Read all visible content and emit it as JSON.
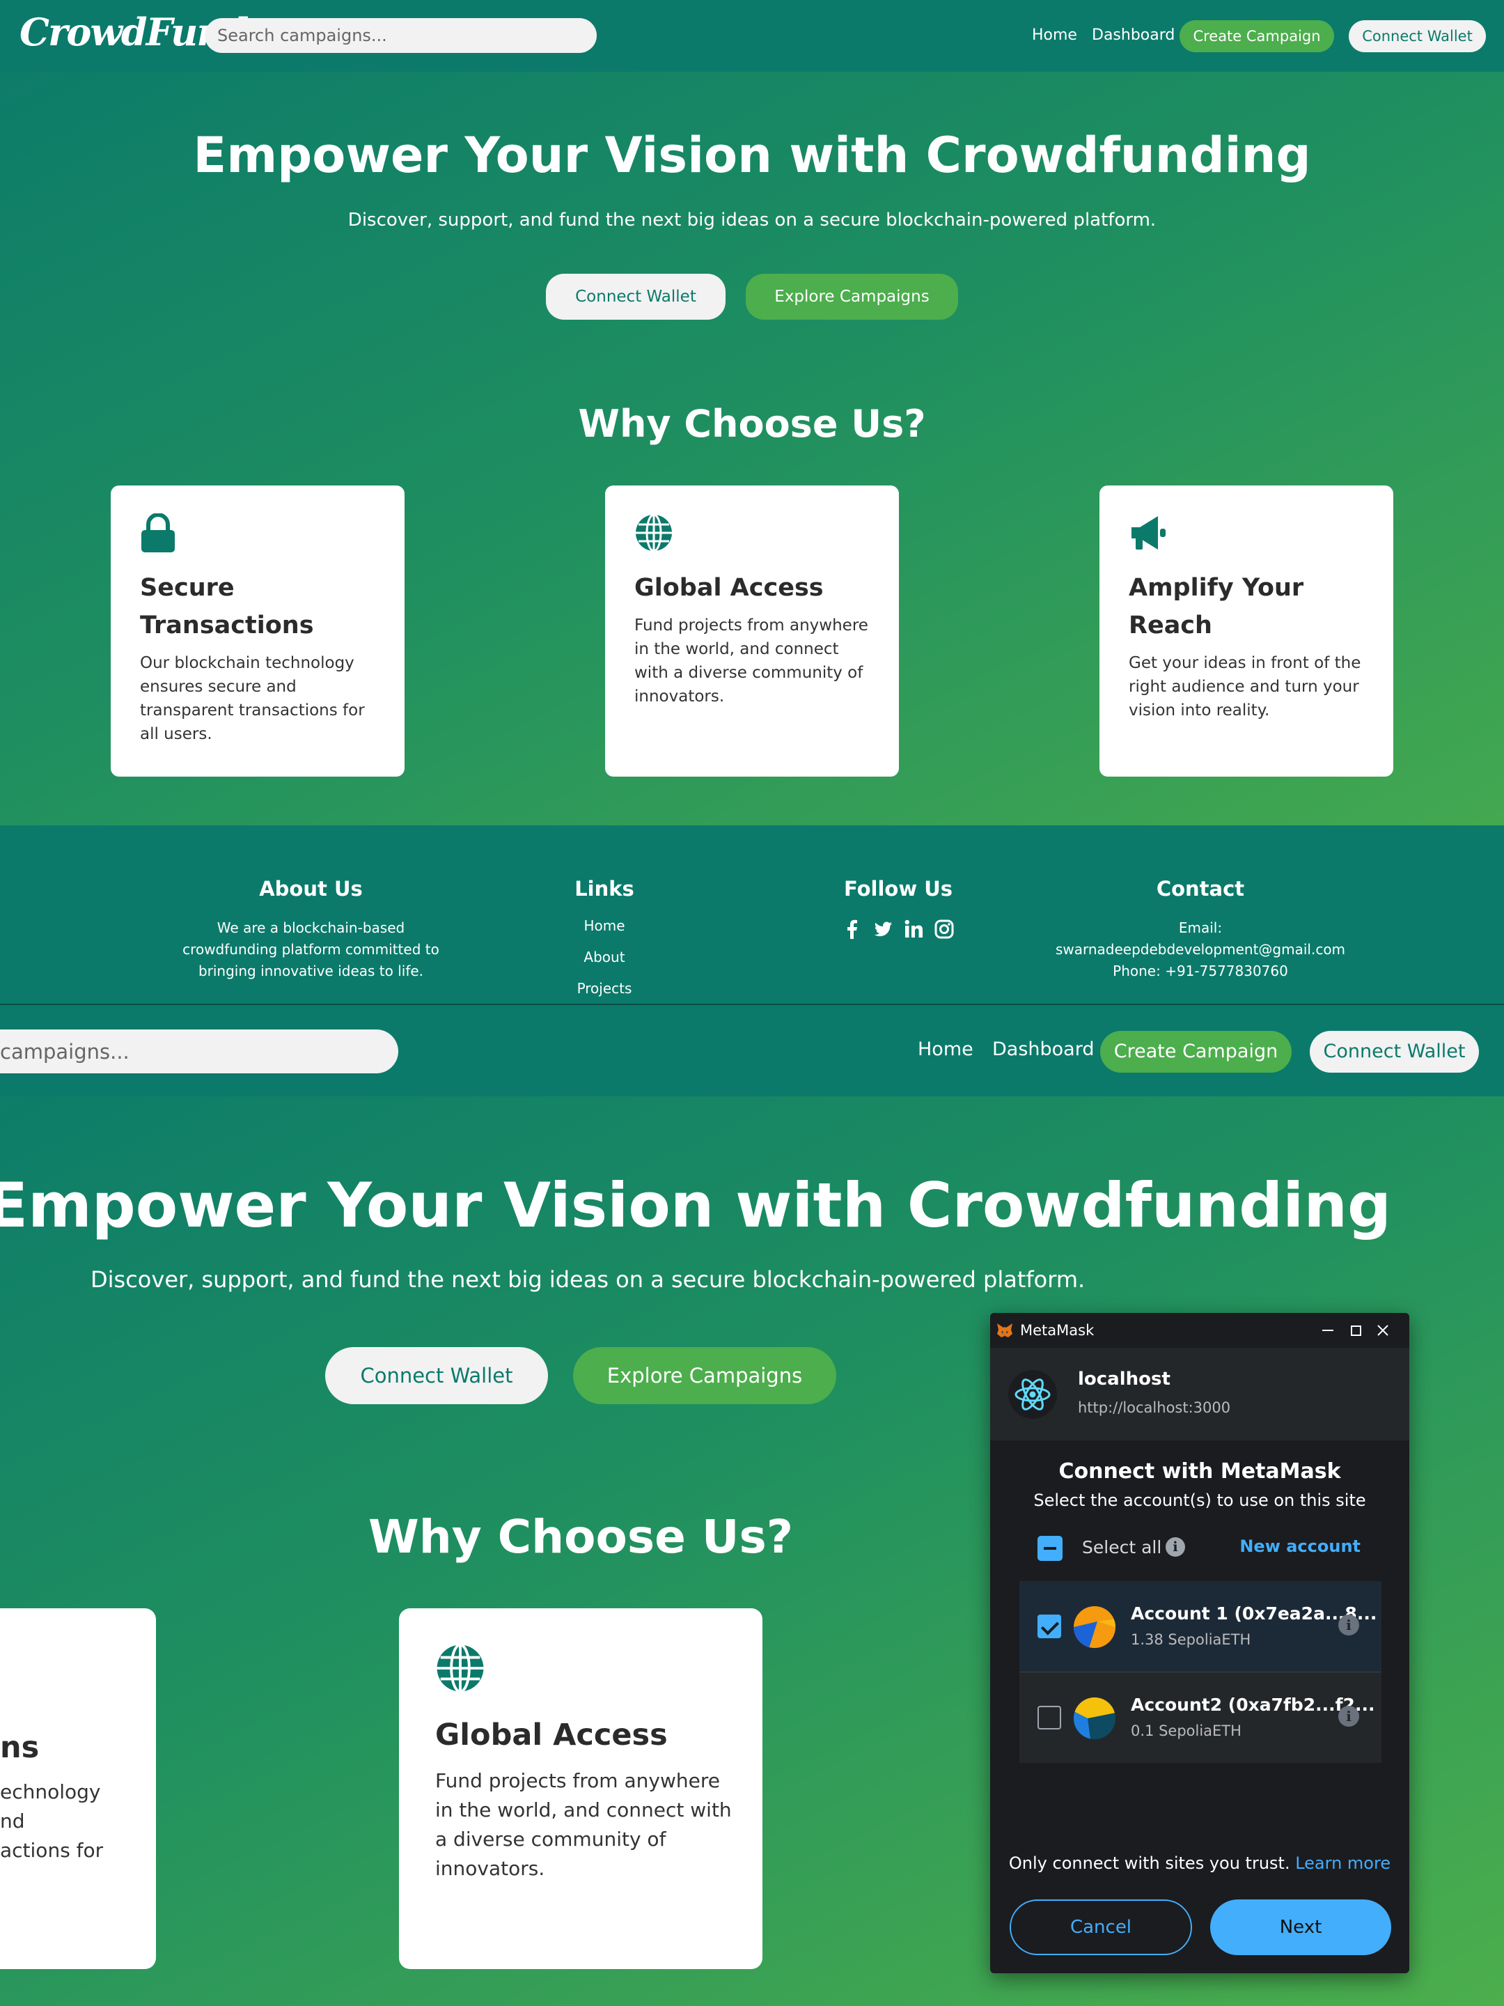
{
  "nav": {
    "logo": "CrowdFund",
    "search_placeholder": "Search campaigns...",
    "search_placeholder_zoomed": "campaigns...",
    "home": "Home",
    "dashboard": "Dashboard",
    "create": "Create Campaign",
    "connect": "Connect Wallet"
  },
  "hero": {
    "title": "Empower Your Vision with Crowdfunding",
    "subtitle": "Discover, support, and fund the next big ideas on a secure blockchain-powered platform.",
    "connect_button": "Connect Wallet",
    "explore_button": "Explore Campaigns"
  },
  "why": {
    "heading": "Why Choose Us?",
    "cards": [
      {
        "icon": "lock-icon",
        "title": "Secure Transactions",
        "desc": "Our blockchain technology ensures secure and transparent transactions for all users."
      },
      {
        "icon": "globe-icon",
        "title": "Global Access",
        "desc": "Fund projects from anywhere in the world, and connect with a diverse community of innovators."
      },
      {
        "icon": "megaphone-icon",
        "title": "Amplify Your Reach",
        "desc": "Get your ideas in front of the right audience and turn your vision into reality."
      }
    ],
    "cropped_card": {
      "title": "ns",
      "lines": [
        "echnology",
        "nd",
        "actions for"
      ]
    }
  },
  "footer": {
    "about_title": "About Us",
    "about_text": "We are a blockchain-based crowdfunding platform committed to bringing innovative ideas to life.",
    "links_title": "Links",
    "links": [
      "Home",
      "About",
      "Projects"
    ],
    "follow_title": "Follow Us",
    "social_icons": [
      "facebook-icon",
      "twitter-icon",
      "linkedin-icon",
      "instagram-icon"
    ],
    "contact_title": "Contact",
    "contact_email_label": "Email:",
    "contact_email": "swarnadeepdebdevelopment@gmail.com",
    "contact_phone": "Phone: +91-7577830760"
  },
  "metamask": {
    "window_title": "MetaMask",
    "site_host": "localhost",
    "site_url": "http://localhost:3000",
    "heading": "Connect with MetaMask",
    "subheading": "Select the account(s) to use on this site",
    "select_all": "Select all",
    "new_account": "New account",
    "accounts": [
      {
        "name": "Account 1 (0x7ea2a...8...",
        "balance": "1.38 SepoliaETH",
        "selected": true
      },
      {
        "name": "Account2 (0xa7fb2...f2...",
        "balance": "0.1 SepoliaETH",
        "selected": false
      }
    ],
    "trust_text": "Only connect with sites you trust.",
    "learn_more": "Learn more",
    "cancel": "Cancel",
    "next": "Next",
    "accent_color": "#43aefc"
  },
  "colors": {
    "brand_teal": "#0b7a6b",
    "brand_green": "#4cae4c"
  }
}
